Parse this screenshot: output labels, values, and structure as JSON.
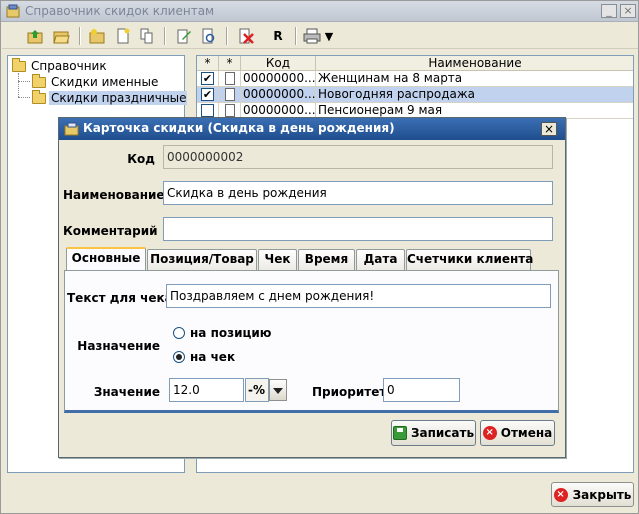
{
  "window": {
    "title": "Справочник скидок клиентам",
    "min": "_",
    "close": "×"
  },
  "toolbar": {
    "r_label": "R",
    "dropdown_glyph": "▼"
  },
  "tree": {
    "root": "Справочник",
    "children": [
      "Скидки именные",
      "Скидки праздничные"
    ]
  },
  "grid": {
    "headers": [
      "*",
      "*",
      "Код",
      "Наименование"
    ],
    "rows": [
      {
        "checked": true,
        "code": "00000000...",
        "name": "Женщинам на 8 марта"
      },
      {
        "checked": true,
        "code": "00000000...",
        "name": "Новогодняя распродажа"
      },
      {
        "checked": false,
        "code": "00000000...",
        "name": "Пенсионерам 9 мая"
      }
    ],
    "check_mark": "✔"
  },
  "close_button": {
    "label": "Закрыть",
    "icon": "×"
  },
  "dialog": {
    "title": "Карточка скидки (Скидка в день рождения)",
    "close": "×",
    "code_label": "Код",
    "code_value": "0000000002",
    "name_label": "Наименование",
    "name_value": "Скидка в день рождения",
    "comment_label": "Комментарий",
    "comment_value": "",
    "tabs": [
      "Основные",
      "Позиция/Товар",
      "Чек",
      "Время",
      "Дата",
      "Счетчики клиента"
    ],
    "active_tab": 0,
    "check_text_label": "Текст для чека",
    "check_text_value": "Поздравляем с днем рождения!",
    "purpose_label": "Назначение",
    "purpose_options": [
      "на позицию",
      "на чек"
    ],
    "purpose_selected": 1,
    "value_label": "Значение",
    "value_value": "12.0",
    "value_unit": "-%",
    "priority_label": "Приоритет",
    "priority_value": "0",
    "save_label": "Записать",
    "cancel_label": "Отмена",
    "cancel_icon": "×"
  },
  "colors": {
    "dialog_title_bg": "#2a5c9e",
    "selection": "#c1d2ee",
    "tab_accent": "#fbc341"
  }
}
